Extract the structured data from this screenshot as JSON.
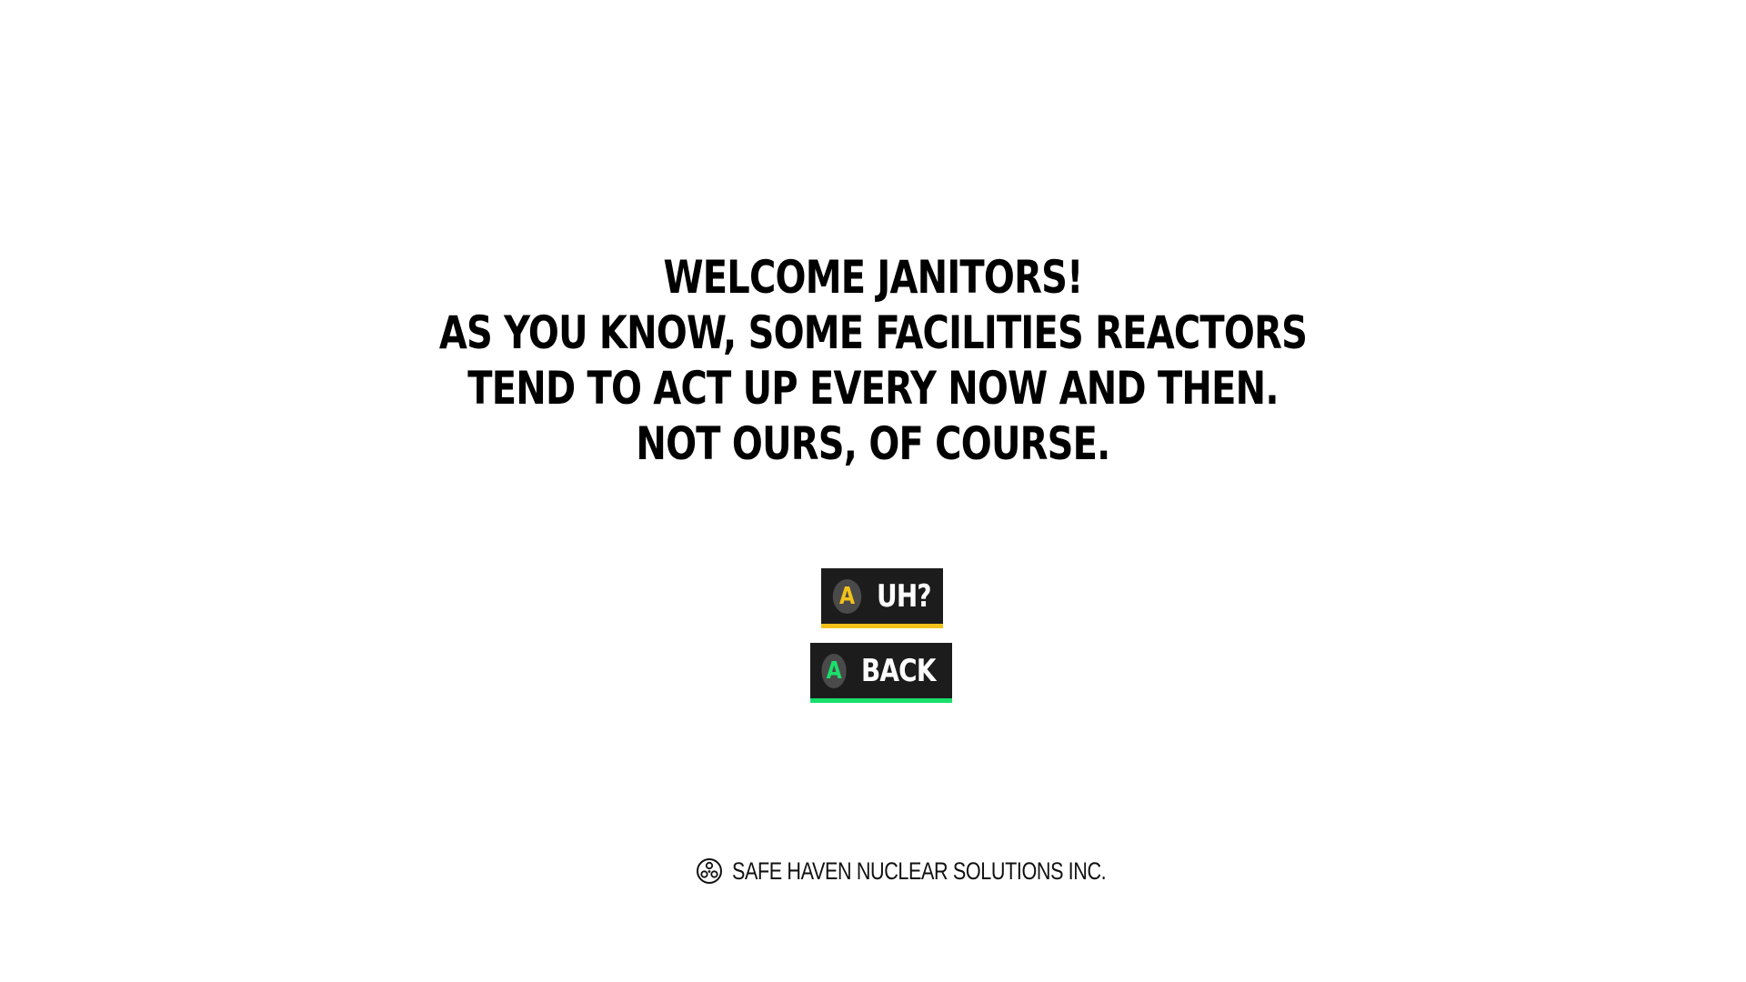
{
  "dialog": {
    "lines": [
      "WELCOME JANITORS!",
      "AS YOU KNOW, SOME  FACILITIES REACTORS",
      "TEND TO ACT UP EVERY NOW AND THEN.",
      "NOT OURS, OF COURSE."
    ]
  },
  "buttons": {
    "uh": {
      "glyph": "A",
      "label": "UH?",
      "accent_color": "#f2c21b"
    },
    "back": {
      "glyph": "A",
      "label": "BACK",
      "accent_color": "#19e06a"
    }
  },
  "footer": {
    "logo_icon": "radiation-logo-icon",
    "company": "SAFE HAVEN NUCLEAR SOLUTIONS INC."
  }
}
